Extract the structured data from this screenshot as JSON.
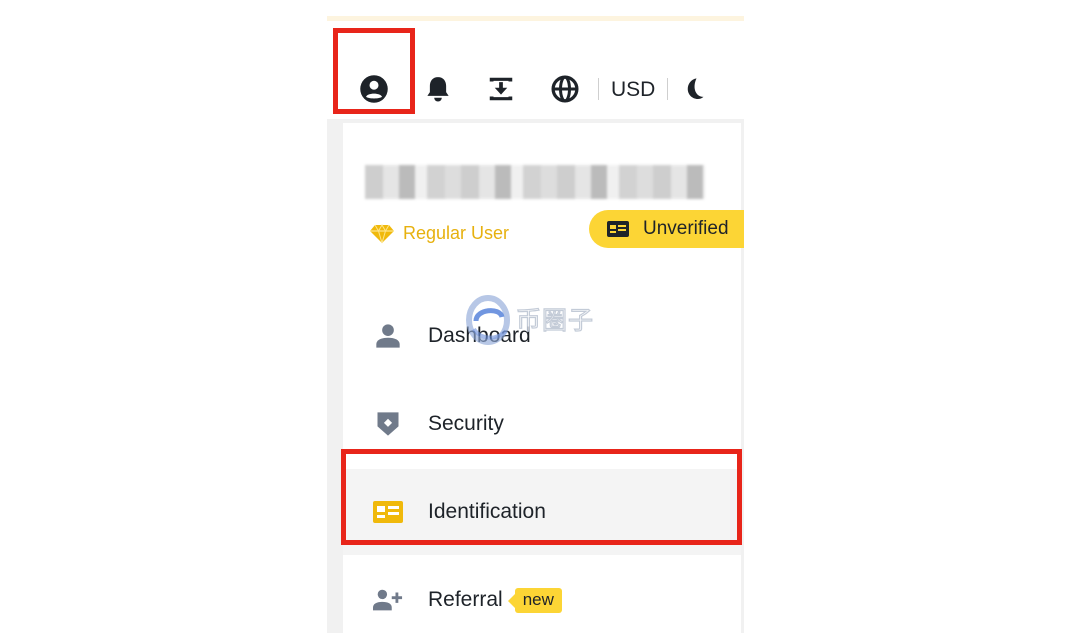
{
  "navbar": {
    "icons": [
      "user-circle-icon",
      "bell-icon",
      "download-icon",
      "globe-icon",
      "moon-icon"
    ],
    "currency": "USD"
  },
  "dropdown": {
    "user_level": "Regular User",
    "verification_status": "Unverified",
    "menu": [
      {
        "label": "Dashboard",
        "icon": "person-icon"
      },
      {
        "label": "Security",
        "icon": "shield-icon"
      },
      {
        "label": "Identification",
        "icon": "id-card-icon"
      },
      {
        "label": "Referral",
        "icon": "add-user-icon",
        "badge": "new"
      }
    ]
  },
  "watermark": {
    "text": "币圈子"
  },
  "colors": {
    "accent_yellow": "#fcd535",
    "level_gold": "#e7b10f",
    "highlight_red": "#e8251a",
    "text_dark": "#1e2329",
    "icon_gray": "#707a8a"
  }
}
